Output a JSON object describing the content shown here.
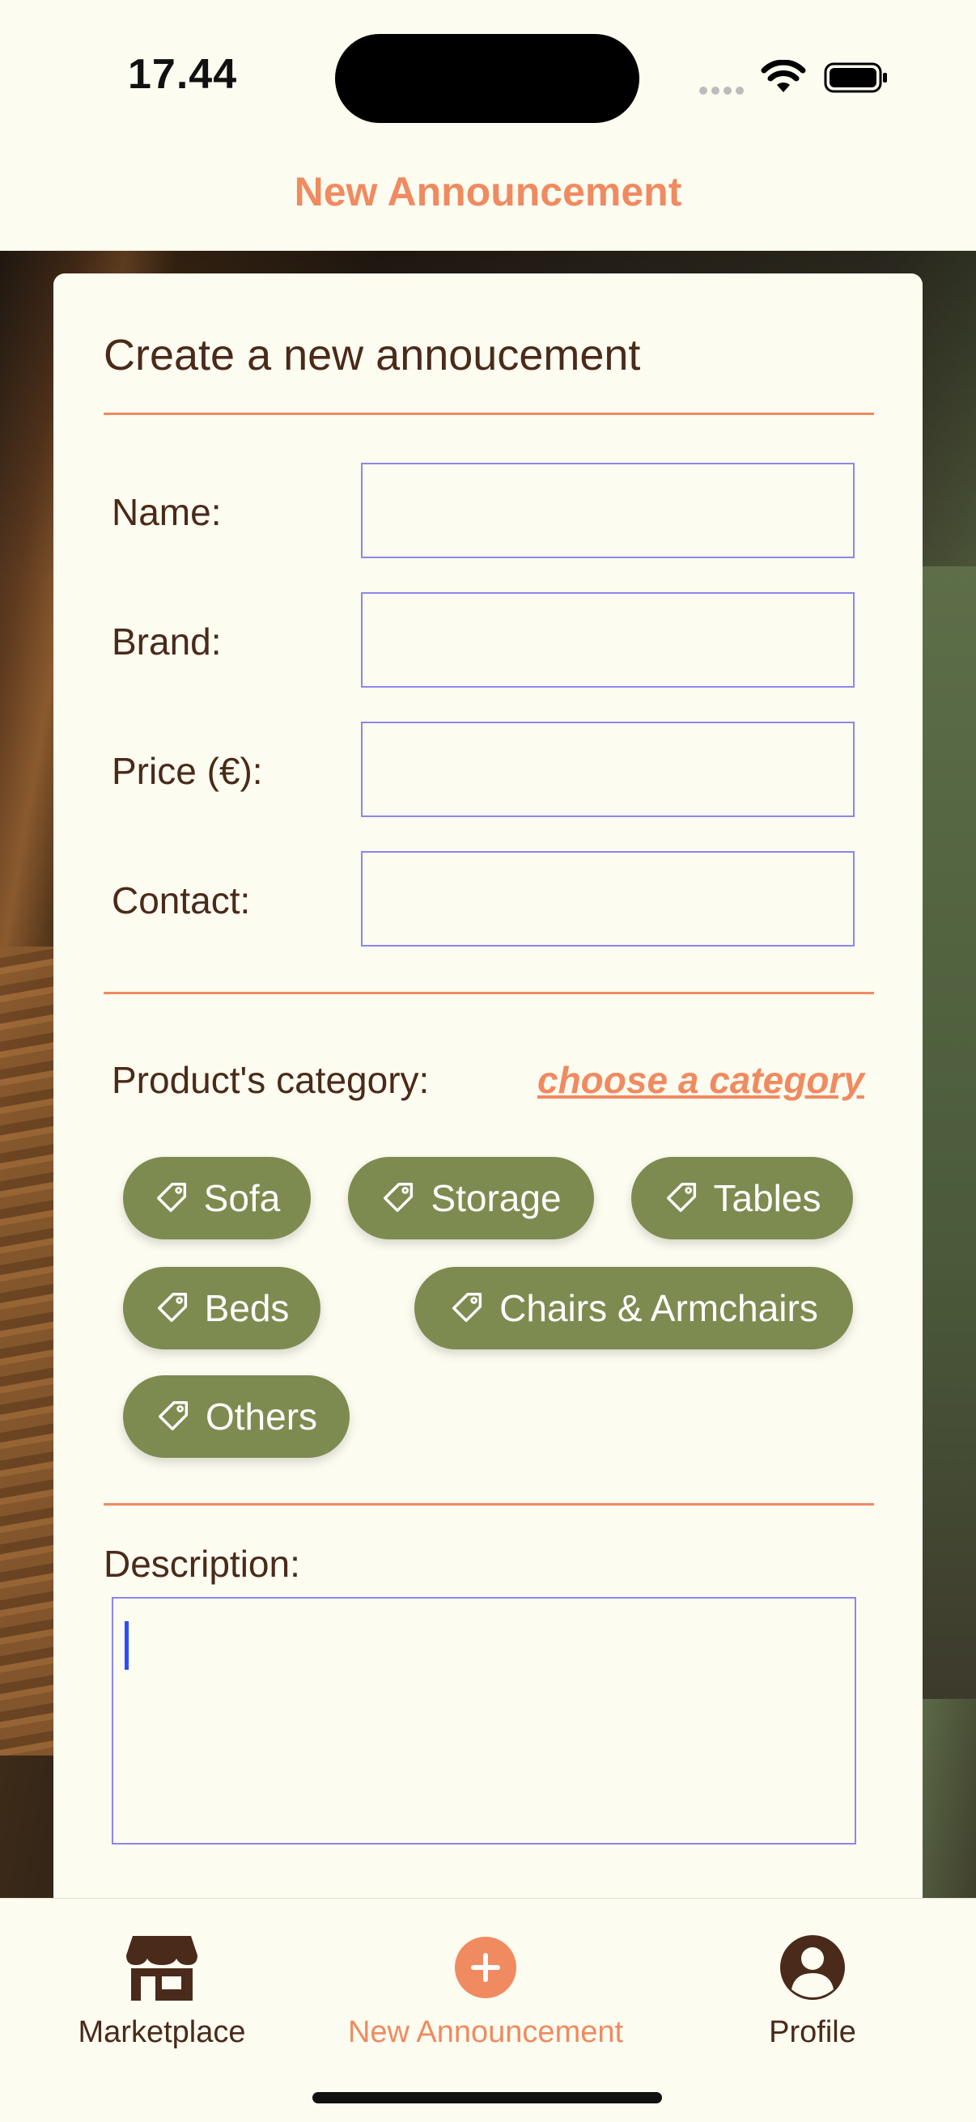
{
  "status_bar": {
    "time": "17.44"
  },
  "header": {
    "title": "New Announcement"
  },
  "form": {
    "title": "Create a new annoucement",
    "fields": [
      {
        "label": "Name:",
        "value": ""
      },
      {
        "label": "Brand:",
        "value": ""
      },
      {
        "label": "Price (€):",
        "value": ""
      },
      {
        "label": "Contact:",
        "value": ""
      }
    ],
    "category": {
      "label": "Product's category:",
      "link": "choose a category",
      "chips": [
        "Sofa",
        "Storage",
        "Tables",
        "Beds",
        "Chairs & Armchairs",
        "Others"
      ]
    },
    "description": {
      "label": "Description:",
      "value": ""
    }
  },
  "tabs": [
    {
      "label": "Marketplace",
      "icon": "store-icon"
    },
    {
      "label": "New Announcement",
      "icon": "plus-circle-icon",
      "active": true
    },
    {
      "label": "Profile",
      "icon": "user-circle-icon"
    }
  ],
  "colors": {
    "accent": "#f08a60",
    "chip": "#7d8b50",
    "text": "#4a2a1a",
    "background": "#fdfcf0"
  }
}
